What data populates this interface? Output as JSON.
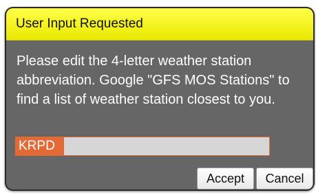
{
  "dialog": {
    "title": "User Input Requested",
    "message": "Please edit the 4-letter weather station abbreviation. Google \"GFS MOS Stations\" to find a list of weather station closest to you.",
    "input_value": "KRPD",
    "accept_label": "Accept",
    "cancel_label": "Cancel"
  },
  "colors": {
    "titlebar": "#f0f000",
    "body": "#666666",
    "input_border": "#e06b2e",
    "selection": "#e36a36"
  }
}
